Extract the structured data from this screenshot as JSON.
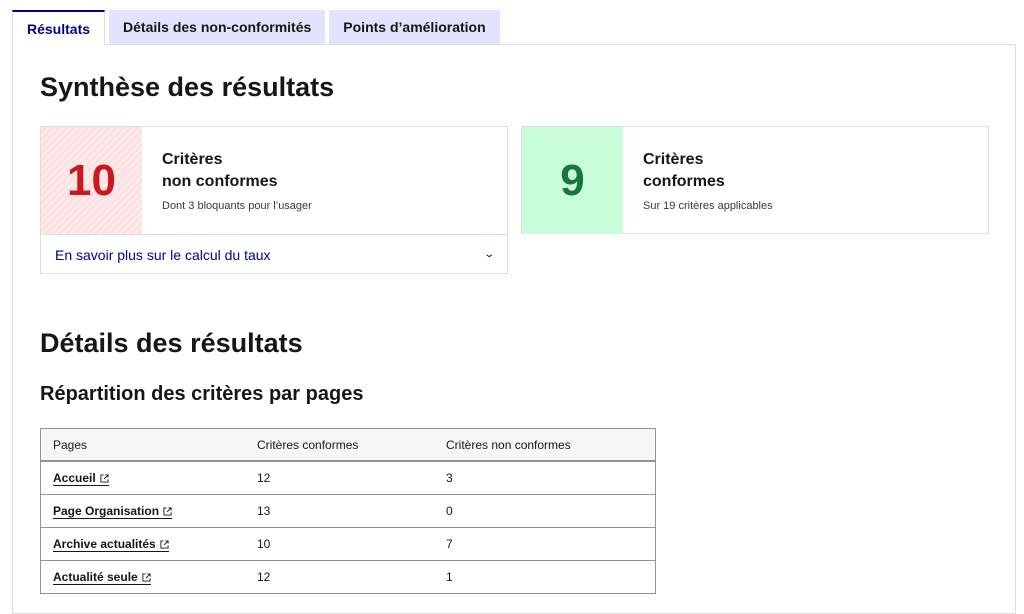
{
  "tabs": [
    {
      "label": "Résultats",
      "active": true
    },
    {
      "label": "Détails des non-conformités",
      "active": false
    },
    {
      "label": "Points d’amélioration",
      "active": false
    }
  ],
  "synthese": {
    "title": "Synthèse des résultats",
    "non_conformes": {
      "count": "10",
      "label_line1": "Critères",
      "label_line2": "non conformes",
      "sub": "Dont 3 bloquants pour l’usager",
      "accordion_label": "En savoir plus sur le calcul du taux",
      "color": "#c9191e"
    },
    "conformes": {
      "count": "9",
      "label_line1": "Critères",
      "label_line2": "conformes",
      "sub": "Sur 19 critères applicables",
      "color": "#18753c"
    }
  },
  "details": {
    "title": "Détails des résultats",
    "subtitle": "Répartition des critères par pages",
    "table": {
      "headers": [
        "Pages",
        "Critères conformes",
        "Critères non conformes"
      ],
      "rows": [
        {
          "page": "Accueil",
          "conformes": "12",
          "non_conformes": "3"
        },
        {
          "page": "Page Organisation",
          "conformes": "13",
          "non_conformes": "0"
        },
        {
          "page": "Archive actualités",
          "conformes": "10",
          "non_conformes": "7"
        },
        {
          "page": "Actualité seule",
          "conformes": "12",
          "non_conformes": "1"
        }
      ]
    }
  },
  "colors": {
    "primary": "#000091",
    "tab_inactive_bg": "#e3e3fd",
    "error": "#c9191e",
    "success": "#18753c",
    "success_bg": "#c9fcd8"
  }
}
